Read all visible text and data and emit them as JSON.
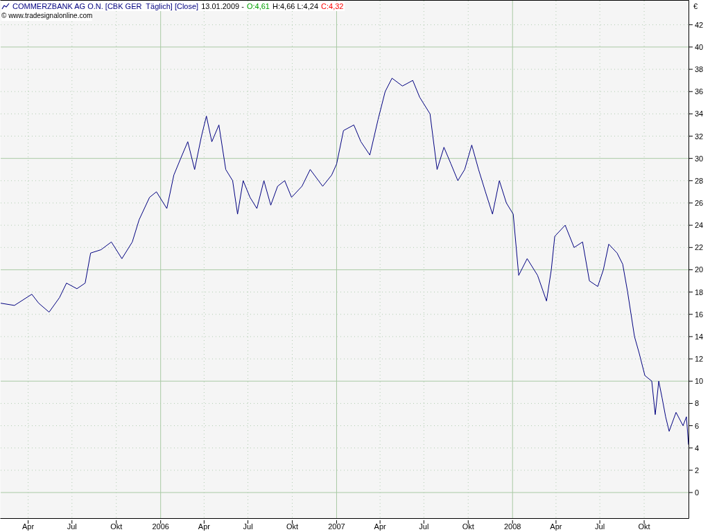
{
  "header": {
    "title_segments": [
      {
        "text": "13.01.2009 -",
        "color": "#000000"
      },
      {
        "text": "O:4,61",
        "color": "#00a000"
      },
      {
        "text": "H:4,66 L:4,24",
        "color": "#000000"
      },
      {
        "text": "C:4,32",
        "color": "#ff0000"
      }
    ],
    "copyright": "© www.tradesignalonline.com"
  },
  "chart": {
    "currency": "€",
    "chart_data": {
      "type": "line",
      "xlim": [
        2005.091,
        2009.0
      ],
      "ylim": [
        -2.3,
        44.16
      ],
      "xticks": [
        {
          "value": 2005.247,
          "label": "Apr"
        },
        {
          "value": 2005.496,
          "label": "Jul"
        },
        {
          "value": 2005.748,
          "label": "Okt"
        },
        {
          "value": 2006,
          "label": "2006"
        },
        {
          "value": 2006.247,
          "label": "Apr"
        },
        {
          "value": 2006.496,
          "label": "Jul"
        },
        {
          "value": 2006.748,
          "label": "Okt"
        },
        {
          "value": 2007,
          "label": "2007"
        },
        {
          "value": 2007.247,
          "label": "Apr"
        },
        {
          "value": 2007.496,
          "label": "Jul"
        },
        {
          "value": 2007.748,
          "label": "Okt"
        },
        {
          "value": 2008,
          "label": "2008"
        },
        {
          "value": 2008.247,
          "label": "Apr"
        },
        {
          "value": 2008.496,
          "label": "Jul"
        },
        {
          "value": 2008.748,
          "label": "Okt"
        }
      ],
      "yticks": [
        0,
        2,
        4,
        6,
        8,
        10,
        12,
        14,
        16,
        18,
        20,
        22,
        24,
        26,
        28,
        30,
        32,
        34,
        36,
        38,
        40,
        42
      ],
      "x": [
        2005.091,
        2005.169,
        2005.268,
        2005.307,
        2005.366,
        2005.425,
        2005.465,
        2005.524,
        2005.571,
        2005.602,
        2005.661,
        2005.72,
        2005.78,
        2005.839,
        2005.878,
        2005.937,
        2005.976,
        2006.035,
        2006.075,
        2006.114,
        2006.154,
        2006.193,
        2006.232,
        2006.26,
        2006.291,
        2006.331,
        2006.37,
        2006.409,
        2006.437,
        2006.469,
        2006.508,
        2006.547,
        2006.587,
        2006.626,
        2006.665,
        2006.705,
        2006.744,
        2006.803,
        2006.85,
        2006.921,
        2006.972,
        2007.0,
        2007.039,
        2007.098,
        2007.138,
        2007.189,
        2007.236,
        2007.276,
        2007.315,
        2007.374,
        2007.433,
        2007.472,
        2007.531,
        2007.571,
        2007.61,
        2007.65,
        2007.689,
        2007.728,
        2007.768,
        2007.807,
        2007.846,
        2007.886,
        2007.925,
        2007.965,
        2008.004,
        2008.035,
        2008.083,
        2008.142,
        2008.193,
        2008.22,
        2008.24,
        2008.299,
        2008.35,
        2008.398,
        2008.437,
        2008.484,
        2008.516,
        2008.547,
        2008.594,
        2008.626,
        2008.654,
        2008.693,
        2008.72,
        2008.752,
        2008.791,
        2008.811,
        2008.831,
        2008.85,
        2008.87,
        2008.89,
        2008.929,
        2008.969,
        2008.988,
        2009.0
      ],
      "grid": true,
      "series": [
        {
          "name": "COMMERZBANK AG O.N. [CBK GER  Täglich] [Close]",
          "color": "#000080",
          "values": [
            17,
            16.8,
            17.8,
            17,
            16.2,
            17.5,
            18.8,
            18.3,
            18.8,
            21.5,
            21.8,
            22.5,
            21,
            22.5,
            24.5,
            26.5,
            27,
            25.5,
            28.5,
            30,
            31.5,
            29,
            32,
            33.8,
            31.5,
            33,
            29,
            28,
            25,
            28,
            26.5,
            25.5,
            28,
            25.8,
            27.5,
            28,
            26.5,
            27.5,
            29,
            27.5,
            28.5,
            29.5,
            32.5,
            33,
            31.5,
            30.3,
            33.5,
            36,
            37.2,
            36.5,
            37,
            35.5,
            34,
            29,
            31,
            29.5,
            28,
            29,
            31.2,
            29,
            27,
            25,
            28,
            26,
            25,
            19.5,
            21,
            19.5,
            17.2,
            20,
            23,
            24,
            22,
            22.5,
            19,
            18.5,
            20,
            22.3,
            21.5,
            20.5,
            18,
            14,
            12.5,
            10.5,
            10,
            7,
            10,
            8.5,
            6.8,
            5.5,
            7.2,
            6,
            6.8,
            4.3
          ]
        }
      ]
    }
  }
}
